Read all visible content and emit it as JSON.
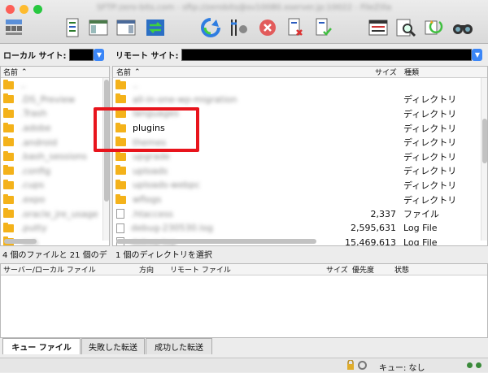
{
  "window": {
    "title": "SFTP:zero-bits.com - sftp://zerobits@sv10080.xserver.jp:10022 - FileZilla"
  },
  "icons": [
    "site-manager-icon",
    "log-toggle-icon",
    "tree-local-icon",
    "tree-remote-icon",
    "sync-transfer-icon",
    "refresh-icon",
    "process-queue-icon",
    "cancel-icon",
    "disconnect-icon",
    "reconnect-icon",
    "filter-icon",
    "search-remote-icon",
    "compare-icon",
    "find-icon"
  ],
  "local_site": {
    "label": "ローカル サイト:",
    "value": ""
  },
  "remote_site": {
    "label": "リモート サイト:",
    "value": ""
  },
  "local_pane": {
    "col_name": "名前",
    "items": [
      "..",
      ".DS_Preview",
      ".Trash",
      ".adobe",
      ".android",
      ".bash_sessions",
      ".config",
      ".cups",
      ".expo",
      ".oracle_jre_usage",
      ".putty",
      ".ssh"
    ],
    "status": "4 個のファイルと 21 個のデ"
  },
  "remote_pane": {
    "col_name": "名前",
    "col_size": "サイズ",
    "col_type": "種類",
    "rows": [
      {
        "name": "..",
        "size": "",
        "type": "",
        "kind": "folder"
      },
      {
        "name": "all-in-one-wp-migration",
        "size": "",
        "type": "ディレクトリ",
        "kind": "folder"
      },
      {
        "name": "languages",
        "size": "",
        "type": "ディレクトリ",
        "kind": "folder"
      },
      {
        "name": "plugins",
        "size": "",
        "type": "ディレクトリ",
        "kind": "folder"
      },
      {
        "name": "themes",
        "size": "",
        "type": "ディレクトリ",
        "kind": "folder"
      },
      {
        "name": "upgrade",
        "size": "",
        "type": "ディレクトリ",
        "kind": "folder"
      },
      {
        "name": "uploads",
        "size": "",
        "type": "ディレクトリ",
        "kind": "folder"
      },
      {
        "name": "uploads-webpc",
        "size": "",
        "type": "ディレクトリ",
        "kind": "folder"
      },
      {
        "name": "wflogs",
        "size": "",
        "type": "ディレクトリ",
        "kind": "folder"
      },
      {
        "name": ".htaccess",
        "size": "2,337",
        "type": "ファイル",
        "kind": "file"
      },
      {
        "name": "debug-230530.log",
        "size": "2,595,631",
        "type": "Log File",
        "kind": "file"
      },
      {
        "name": "debug.log",
        "size": "15,469,613",
        "type": "Log File",
        "kind": "file"
      }
    ],
    "highlighted": "plugins",
    "status": "1 個のディレクトリを選択"
  },
  "queue": {
    "col_server": "サーバー/ローカル ファイル",
    "col_dir": "方向",
    "col_remote": "リモート ファイル",
    "col_size": "サイズ",
    "col_priority": "優先度",
    "col_status": "状態"
  },
  "tabs": [
    "キュー ファイル",
    "失敗した転送",
    "成功した転送"
  ],
  "footer": {
    "queue_text": "キュー: なし"
  },
  "colors": {
    "accent": "#3b86f7",
    "highlight": "#e8141c",
    "folder": "#f4b21a"
  }
}
